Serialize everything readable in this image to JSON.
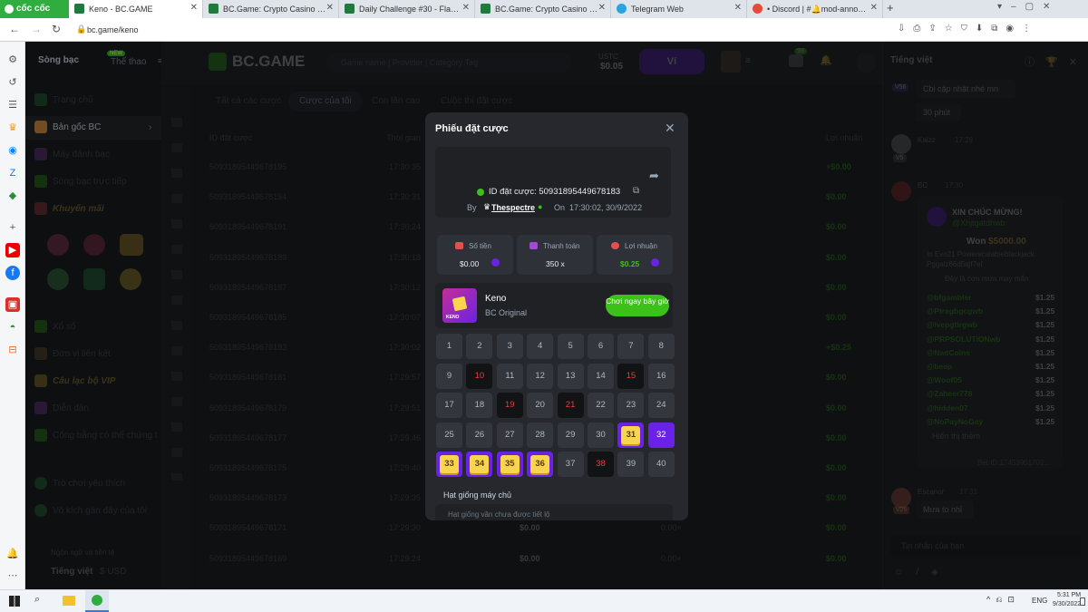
{
  "browser": {
    "tabs": [
      {
        "title": "Keno - BC.GAME",
        "active": true,
        "icon": "bc-game-icon"
      },
      {
        "title": "BC.Game: Crypto Casino Gam",
        "icon": "bc-game-icon"
      },
      {
        "title": "Daily Challenge #30 - Flash C",
        "icon": "bc-game-icon"
      },
      {
        "title": "BC.Game: Crypto Casino Gam",
        "icon": "bc-game-icon"
      },
      {
        "title": "Telegram Web",
        "icon": "telegram-icon"
      },
      {
        "title": "• Discord | #🔔mod-announc",
        "icon": "discord-icon"
      }
    ],
    "brand": "cốc cốc",
    "url": "bc.game/keno"
  },
  "sidebar": {
    "top_tabs": [
      "Sòng bạc",
      "Thể thao"
    ],
    "new_badge": "NEW",
    "items": [
      {
        "label": "Trang chủ"
      },
      {
        "label": "Bản gốc BC"
      },
      {
        "label": "Máy đánh bạc"
      },
      {
        "label": "Sòng bạc trực tiếp"
      },
      {
        "label": "Khuyến mãi"
      },
      {
        "label": "Xổ số"
      },
      {
        "label": "Đơn vị liên kết"
      },
      {
        "label": "Câu lạc bộ VIP"
      },
      {
        "label": "Diễn đàn"
      },
      {
        "label": "Công bằng có thể chứng t"
      },
      {
        "label": "Trò chơi yêu thích"
      },
      {
        "label": "Vô kích gần đây của tôi"
      }
    ],
    "lang_heading": "Ngôn ngữ và tiền tệ",
    "lang": "Tiếng việt",
    "currency": "$ USD"
  },
  "topbar": {
    "logo": "BC.GAME",
    "search_placeholder": "Game name | Provider | Category Tag",
    "currency": "USTC",
    "balance": "$0.05",
    "wallet": "Ví",
    "notif_count": "99"
  },
  "main": {
    "tabs": [
      "Tất cả các cược",
      "Cược của tôi",
      "Con lăn cao",
      "Cuộc thi đặt cược"
    ],
    "col_id": "ID đặt cược",
    "col_time": "Thời gian",
    "col_profit": "Lợi nhuận",
    "rows": [
      {
        "id": "5093189544967819​5",
        "time": "17:30:35",
        "amount": "",
        "mult": "",
        "profit": "+$0.00"
      },
      {
        "id": "50931895449678194",
        "time": "17:30:31",
        "amount": "",
        "mult": "",
        "profit": "$0.00"
      },
      {
        "id": "50931895449678191",
        "time": "17:30:24",
        "amount": "",
        "mult": "",
        "profit": "$0.00"
      },
      {
        "id": "50931895449678189",
        "time": "17:30:18",
        "amount": "",
        "mult": "",
        "profit": "$0.00"
      },
      {
        "id": "50931895449678187",
        "time": "17:30:12",
        "amount": "",
        "mult": "",
        "profit": "$0.00"
      },
      {
        "id": "50931895449678185",
        "time": "17:30:07",
        "amount": "",
        "mult": "",
        "profit": "$0.00"
      },
      {
        "id": "50931895449678183",
        "time": "17:30:02",
        "amount": "",
        "mult": "",
        "profit": "+$0.25"
      },
      {
        "id": "50931895449678181",
        "time": "17:29:57",
        "amount": "",
        "mult": "",
        "profit": "$0.00"
      },
      {
        "id": "50931895449678179",
        "time": "17:29:51",
        "amount": "",
        "mult": "",
        "profit": "$0.00"
      },
      {
        "id": "50931895449678177",
        "time": "17:29:46",
        "amount": "",
        "mult": "",
        "profit": "$0.00"
      },
      {
        "id": "50931895449678175",
        "time": "17:29:40",
        "amount": "",
        "mult": "",
        "profit": "$0.00"
      },
      {
        "id": "50931895449678173",
        "time": "17:29:35",
        "amount": "",
        "mult": "",
        "profit": "$0.00"
      },
      {
        "id": "50931895449678171",
        "time": "17:29:30",
        "amount": "$0.00",
        "mult": "0.00×",
        "profit": "$0.00"
      },
      {
        "id": "50931895449678169",
        "time": "17:29:24",
        "amount": "$0.00",
        "mult": "0.00×",
        "profit": "$0.00"
      }
    ]
  },
  "modal": {
    "title": "Phiếu đặt cược",
    "bet_id_label": "ID đặt cược: 50931895449678183",
    "by_label": "By",
    "user": "Thespectre",
    "on_label": "On",
    "datetime": "17:30:02, 30/9/2022",
    "stats": [
      {
        "label": "Số tiền",
        "value": "$0.00"
      },
      {
        "label": "Thanh toán",
        "value": "350 x"
      },
      {
        "label": "Lợi nhuận",
        "value": "$0.25"
      }
    ],
    "game_name": "Keno",
    "game_sub": "BC Original",
    "thumb_text": "KENO",
    "play_btn": "Chơi ngay bây giờ",
    "seed_label": "Hạt giống máy chủ",
    "seed_hint": "Hạt giống văn chưa được tiết lộ",
    "grid": [
      {
        "n": "1",
        "s": ""
      },
      {
        "n": "2",
        "s": ""
      },
      {
        "n": "3",
        "s": ""
      },
      {
        "n": "4",
        "s": ""
      },
      {
        "n": "5",
        "s": ""
      },
      {
        "n": "6",
        "s": ""
      },
      {
        "n": "7",
        "s": ""
      },
      {
        "n": "8",
        "s": ""
      },
      {
        "n": "9",
        "s": ""
      },
      {
        "n": "10",
        "s": "hit"
      },
      {
        "n": "11",
        "s": ""
      },
      {
        "n": "12",
        "s": ""
      },
      {
        "n": "13",
        "s": ""
      },
      {
        "n": "14",
        "s": ""
      },
      {
        "n": "15",
        "s": "hit"
      },
      {
        "n": "16",
        "s": ""
      },
      {
        "n": "17",
        "s": ""
      },
      {
        "n": "18",
        "s": ""
      },
      {
        "n": "19",
        "s": "hit"
      },
      {
        "n": "20",
        "s": ""
      },
      {
        "n": "21",
        "s": "hit"
      },
      {
        "n": "22",
        "s": ""
      },
      {
        "n": "23",
        "s": ""
      },
      {
        "n": "24",
        "s": ""
      },
      {
        "n": "25",
        "s": ""
      },
      {
        "n": "26",
        "s": ""
      },
      {
        "n": "27",
        "s": ""
      },
      {
        "n": "28",
        "s": ""
      },
      {
        "n": "29",
        "s": ""
      },
      {
        "n": "30",
        "s": ""
      },
      {
        "n": "31",
        "s": "sel"
      },
      {
        "n": "32",
        "s": "selnohit"
      },
      {
        "n": "33",
        "s": "sel"
      },
      {
        "n": "34",
        "s": "sel"
      },
      {
        "n": "35",
        "s": "sel"
      },
      {
        "n": "36",
        "s": "sel"
      },
      {
        "n": "37",
        "s": ""
      },
      {
        "n": "38",
        "s": "hit"
      },
      {
        "n": "39",
        "s": ""
      },
      {
        "n": "40",
        "s": ""
      }
    ]
  },
  "chat": {
    "lang": "Tiếng việt",
    "messages": [
      {
        "badge": "V56",
        "text": "Cbi cập nhật nhé mn"
      },
      {
        "badge": "",
        "text": "30 phút"
      },
      {
        "name": "Kaizz",
        "badge": "V5",
        "time": "17:29"
      },
      {
        "name": "BC",
        "time": "17:30"
      }
    ],
    "congrats": "XIN CHÚC MỪNG!",
    "winner": "@Xhjtgatdhwb",
    "won_label": "Won",
    "won_amount": "$5000.00",
    "game_line": "In Evo21 Powerscalableblackjack",
    "hash_line": "Pggalz66d5qjf7ef",
    "rain_line": "Đây là cơn mưa may mắn",
    "winners": [
      {
        "name": "@bfgambler",
        "amount": "$1.25"
      },
      {
        "name": "@Ptregbgcgwb",
        "amount": "$1.25"
      },
      {
        "name": "@Ivepgtirgwb",
        "amount": "$1.25"
      },
      {
        "name": "@PRPSOLUTIONwb",
        "amount": "$1.25"
      },
      {
        "name": "@NadCoins",
        "amount": "$1.25"
      },
      {
        "name": "@beep",
        "amount": "$1.25"
      },
      {
        "name": "@Woof05",
        "amount": "$1.25"
      },
      {
        "name": "@Zaheer778",
        "amount": "$1.25"
      },
      {
        "name": "@hidden07",
        "amount": "$1.25"
      },
      {
        "name": "@NoPayNoGay",
        "amount": "$1.25"
      }
    ],
    "show_more": "Hiển thị thêm",
    "bet_id": "Bet ID:17453901702...",
    "last_user": "Escanor",
    "last_time": "17:31",
    "last_badge": "V26",
    "last_msg": "Mưa to nhỉ",
    "input_placeholder": "Tin nhắn của bạn"
  },
  "taskbar": {
    "lang": "ENG",
    "time": "5:31 PM",
    "date": "9/30/2022"
  },
  "colors": {
    "accent": "#6a23e6",
    "green": "#3bc117",
    "hit_red": "#ef3b3b",
    "gold": "#f8d54c"
  }
}
